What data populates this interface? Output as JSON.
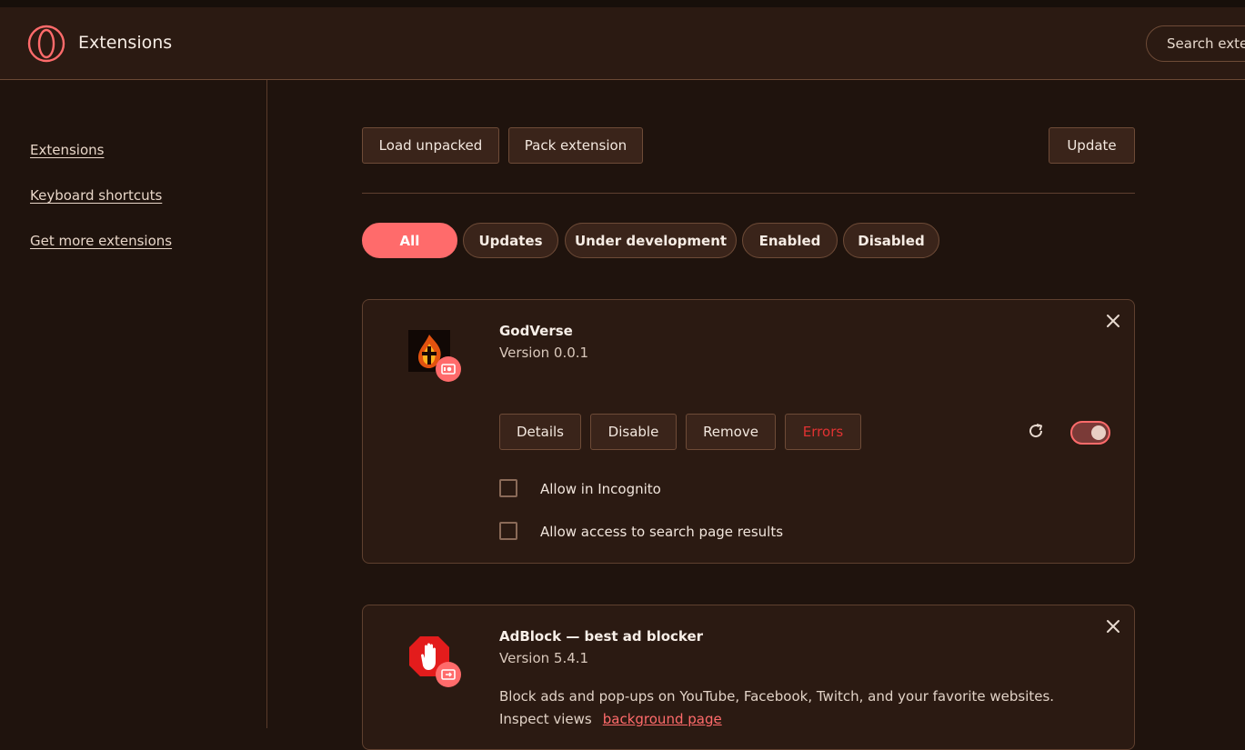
{
  "header": {
    "title": "Extensions",
    "search_placeholder": "Search extensions"
  },
  "sidebar": {
    "items": [
      {
        "label": "Extensions"
      },
      {
        "label": "Keyboard shortcuts"
      },
      {
        "label": "Get more extensions"
      }
    ]
  },
  "toolbar": {
    "load_unpacked": "Load unpacked",
    "pack_extension": "Pack extension",
    "update": "Update"
  },
  "filters": [
    {
      "label": "All",
      "active": true
    },
    {
      "label": "Updates",
      "active": false
    },
    {
      "label": "Under development",
      "active": false
    },
    {
      "label": "Enabled",
      "active": false
    },
    {
      "label": "Disabled",
      "active": false
    }
  ],
  "extensions": [
    {
      "name": "GodVerse",
      "version": "Version 0.0.1",
      "buttons": {
        "details": "Details",
        "disable": "Disable",
        "remove": "Remove",
        "errors": "Errors"
      },
      "options": [
        {
          "label": "Allow in Incognito",
          "checked": false
        },
        {
          "label": "Allow access to search page results",
          "checked": false
        }
      ],
      "enabled": true
    },
    {
      "name": "AdBlock — best ad blocker",
      "version": "Version 5.4.1",
      "description": "Block ads and pop-ups on YouTube, Facebook, Twitch, and your favorite websites.",
      "inspect_label": "Inspect views",
      "inspect_link": "background page"
    }
  ],
  "colors": {
    "accent": "#ff6b6b",
    "background": "#1f130d",
    "header": "#2b1a12",
    "error": "#e03232"
  },
  "icons": {
    "logo": "opera-gx-logo-icon",
    "close": "close-icon",
    "reload": "reload-icon",
    "badge": "unpacked-badge-icon"
  }
}
